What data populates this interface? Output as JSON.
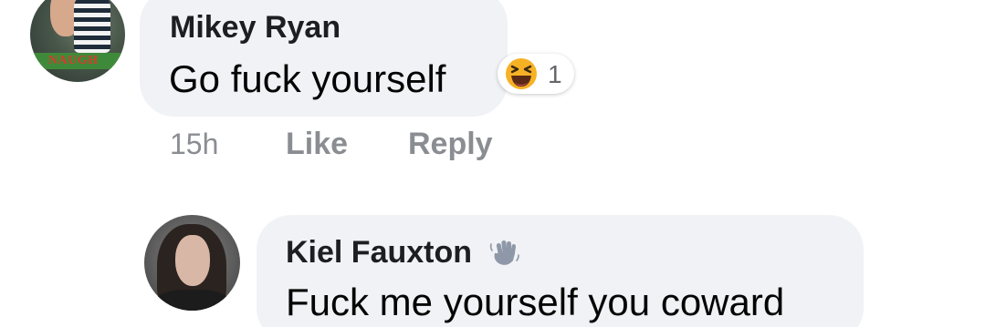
{
  "comments": [
    {
      "author": "Mikey Ryan",
      "text": "Go fuck yourself",
      "avatar_caption": "NAUGH",
      "reaction": {
        "icon": "laughing-emoji-icon",
        "count": "1"
      },
      "time": "15h",
      "actions": {
        "like": "Like",
        "reply": "Reply"
      }
    },
    {
      "author": "Kiel Fauxton",
      "badge_icon": "waving-hand-icon",
      "text": "Fuck me yourself you coward"
    }
  ],
  "colors": {
    "bubble": "#f0f2f5",
    "author_text": "#1c1e21",
    "secondary_text": "#8a8d91",
    "reaction_yellow": "#f7b125"
  }
}
